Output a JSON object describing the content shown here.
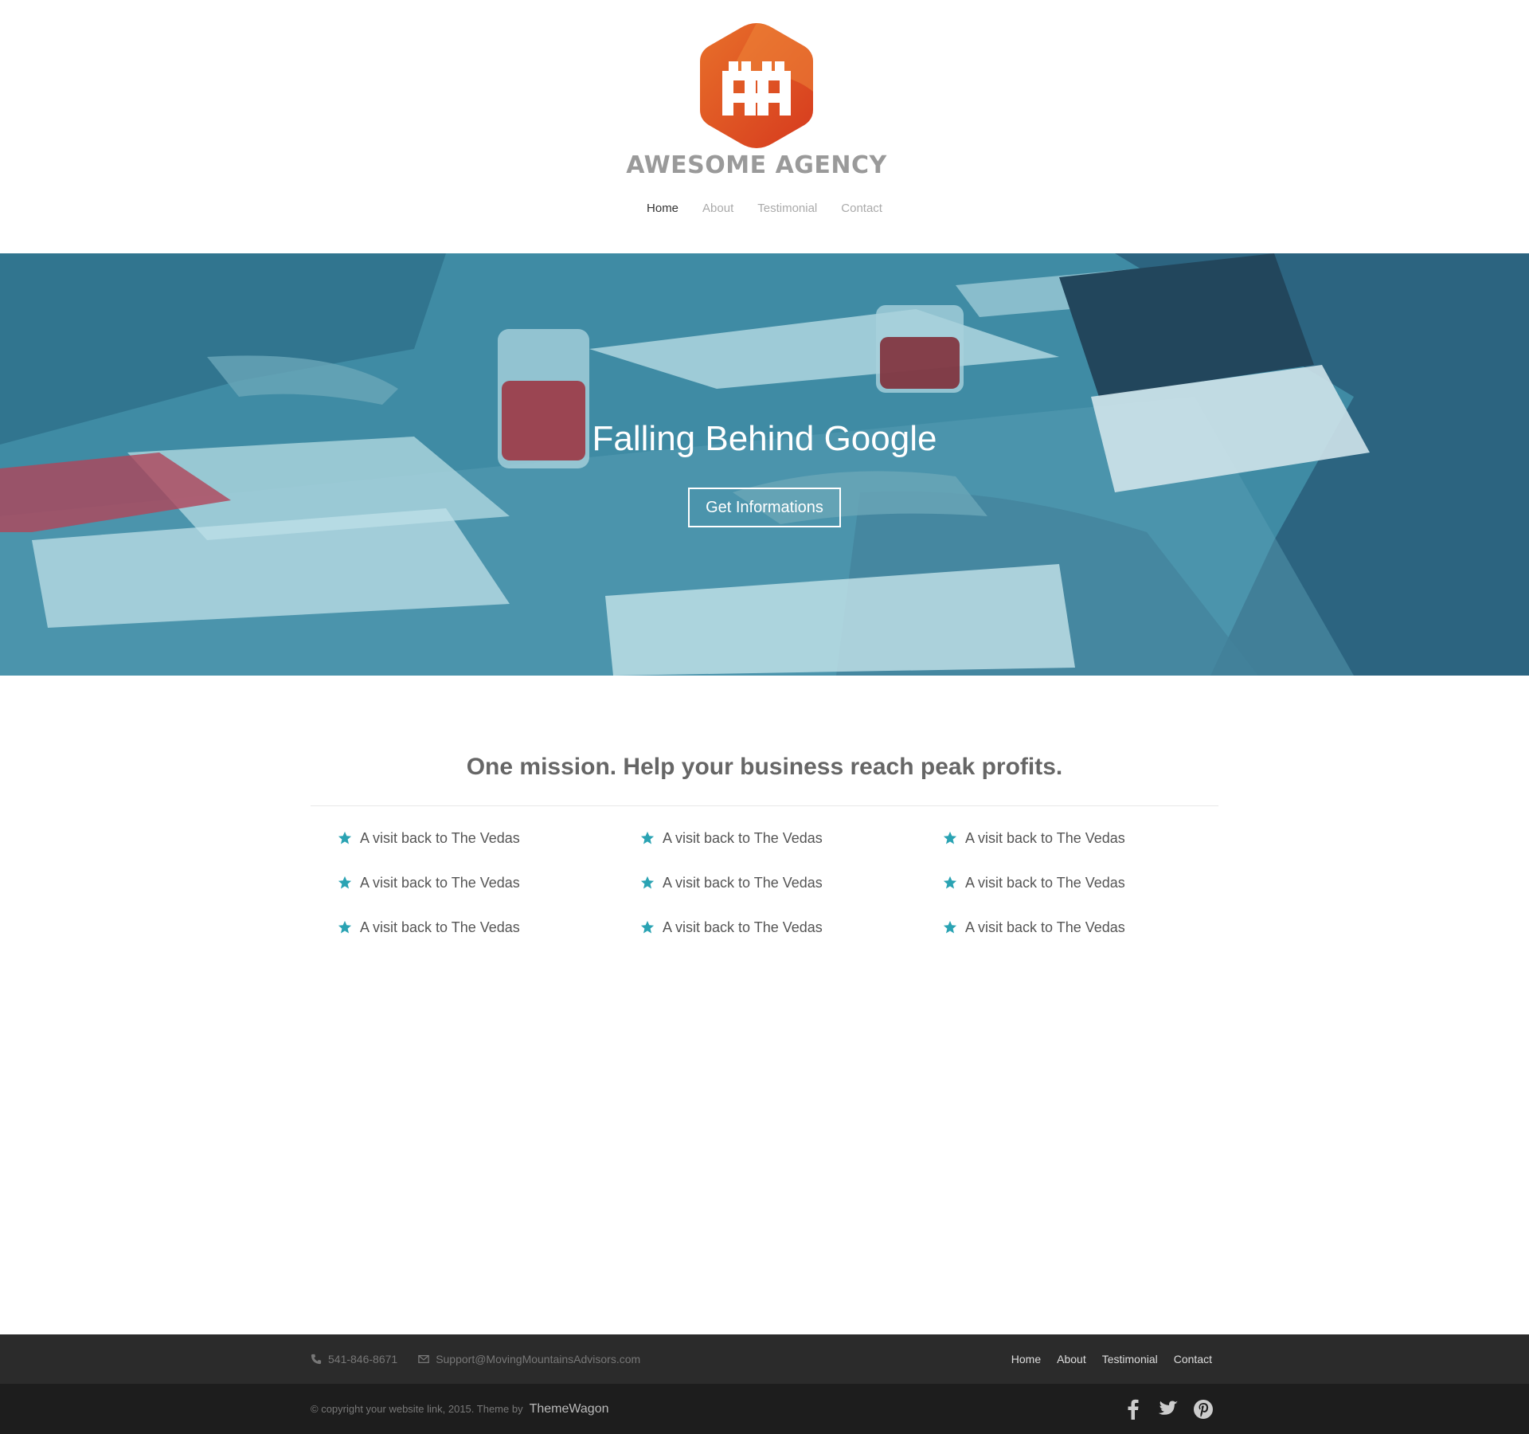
{
  "header": {
    "logo_text": "AWESOME AGENCY",
    "nav": [
      {
        "label": "Home",
        "active": true
      },
      {
        "label": "About",
        "active": false
      },
      {
        "label": "Testimonial",
        "active": false
      },
      {
        "label": "Contact",
        "active": false
      }
    ]
  },
  "hero": {
    "title": "Falling Behind Google",
    "button_label": "Get Informations",
    "overlay_color": "#3d8aa3"
  },
  "mission": {
    "title": "One mission. Help your business reach peak profits.",
    "features": [
      "A visit back to The Vedas",
      "A visit back to The Vedas",
      "A visit back to The Vedas",
      "A visit back to The Vedas",
      "A visit back to The Vedas",
      "A visit back to The Vedas",
      "A visit back to The Vedas",
      "A visit back to The Vedas",
      "A visit back to The Vedas"
    ],
    "icon": "star-icon",
    "accent_color": "#2aa3b3"
  },
  "footer": {
    "phone": "541-846-8671",
    "email": "Support@MovingMountainsAdvisors.com",
    "nav": [
      "Home",
      "About",
      "Testimonial",
      "Contact"
    ],
    "copyright": "© copyright your website link, 2015. Theme by",
    "brand": "ThemeWagon",
    "social": [
      "facebook-icon",
      "twitter-icon",
      "pinterest-icon"
    ]
  }
}
